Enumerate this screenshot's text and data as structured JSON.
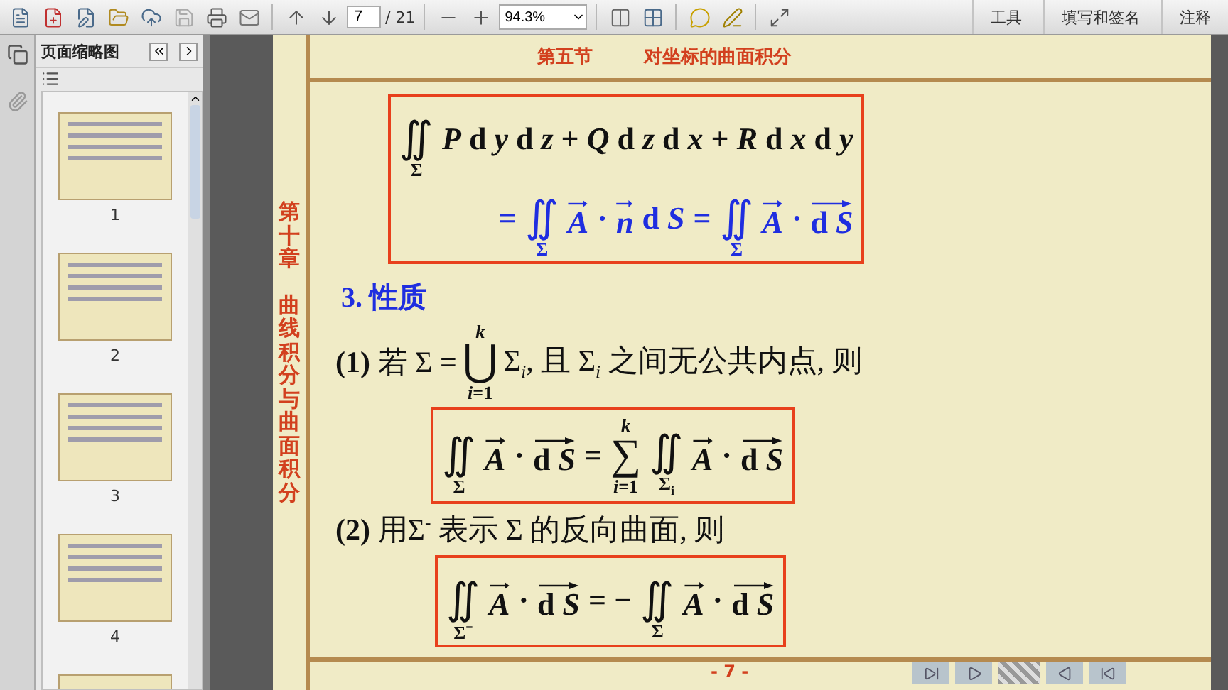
{
  "toolbar": {
    "page_field": "7",
    "page_total": "/ 21",
    "zoom": "94.3%",
    "panel_tabs": [
      "工具",
      "填写和签名",
      "注释"
    ]
  },
  "sidebar": {
    "title": "页面缩略图",
    "thumbnails": [
      {
        "label": "1",
        "cut_off": false
      },
      {
        "label": "2",
        "cut_off": false
      },
      {
        "label": "3",
        "cut_off": false
      },
      {
        "label": "4",
        "cut_off": false
      },
      {
        "cut_off": true
      }
    ]
  },
  "slide": {
    "section_title": "第五节",
    "section_name": "对坐标的曲面积分",
    "chapter": [
      "第十章",
      "曲线积分与曲面积分"
    ],
    "blocks": [
      {
        "kind": "formula_box",
        "lines": [
          {
            "highlighted": false,
            "tokens": [
              {
                "kind": "op",
                "op": "∬",
                "sub": "Σ"
              },
              {
                "kind": "text",
                "text": "*P* d *y* d *z* + *Q* d *z* d *x* + *R* d *x* d *y*"
              }
            ]
          },
          {
            "highlighted": true,
            "tokens": [
              {
                "kind": "text",
                "text": "="
              },
              {
                "kind": "op",
                "op": "∬",
                "sub": "Σ"
              },
              {
                "kind": "vec",
                "text": "*A*"
              },
              {
                "kind": "text",
                "text": "·"
              },
              {
                "kind": "vec",
                "text": "*n*"
              },
              {
                "kind": "text",
                "text": "d *S*"
              },
              {
                "kind": "text",
                "text": "="
              },
              {
                "kind": "op",
                "op": "∬",
                "sub": "Σ"
              },
              {
                "kind": "vec",
                "text": "*A*"
              },
              {
                "kind": "text",
                "text": "·"
              },
              {
                "kind": "vec",
                "text": "d *S*"
              }
            ]
          }
        ]
      },
      {
        "kind": "heading",
        "text": "3. 性质"
      },
      {
        "kind": "statement",
        "tokens": [
          {
            "kind": "text",
            "text": "**(1)** 若 Σ ="
          },
          {
            "kind": "op",
            "op": "⋃",
            "sup": "*k*",
            "sub": "*i*=1"
          },
          {
            "kind": "text",
            "text": "Σ$_{i}$, 且 Σ$_{i}$ 之间无公共内点, 则"
          }
        ]
      },
      {
        "kind": "formula_box",
        "lines": [
          {
            "highlighted": false,
            "tokens": [
              {
                "kind": "op",
                "op": "∬",
                "sub": "Σ"
              },
              {
                "kind": "vec",
                "text": "*A*"
              },
              {
                "kind": "text",
                "text": "·"
              },
              {
                "kind": "vec",
                "text": "d *S*"
              },
              {
                "kind": "text",
                "text": "="
              },
              {
                "kind": "op",
                "op": "∑",
                "sup": "*k*",
                "sub": "*i*=1"
              },
              {
                "kind": "op",
                "op": "∬",
                "sub": "Σ$_{i}$"
              },
              {
                "kind": "vec",
                "text": "*A*"
              },
              {
                "kind": "text",
                "text": "·"
              },
              {
                "kind": "vec",
                "text": "d *S*"
              }
            ]
          }
        ]
      },
      {
        "kind": "statement",
        "tokens": [
          {
            "kind": "text",
            "text": "**(2)** 用Σ$^{-}$ 表示 Σ 的反向曲面, 则"
          }
        ]
      },
      {
        "kind": "formula_box",
        "lines": [
          {
            "highlighted": false,
            "tokens": [
              {
                "kind": "op",
                "op": "∬",
                "sub": "Σ$^{−}$"
              },
              {
                "kind": "vec",
                "text": "*A*"
              },
              {
                "kind": "text",
                "text": "·"
              },
              {
                "kind": "vec",
                "text": "d *S*"
              },
              {
                "kind": "text",
                "text": "= −"
              },
              {
                "kind": "op",
                "op": "∬",
                "sub": "Σ"
              },
              {
                "kind": "vec",
                "text": "*A*"
              },
              {
                "kind": "text",
                "text": "·"
              },
              {
                "kind": "vec",
                "text": "d *S*"
              }
            ]
          }
        ]
      }
    ],
    "page_number": "- 7 -"
  }
}
